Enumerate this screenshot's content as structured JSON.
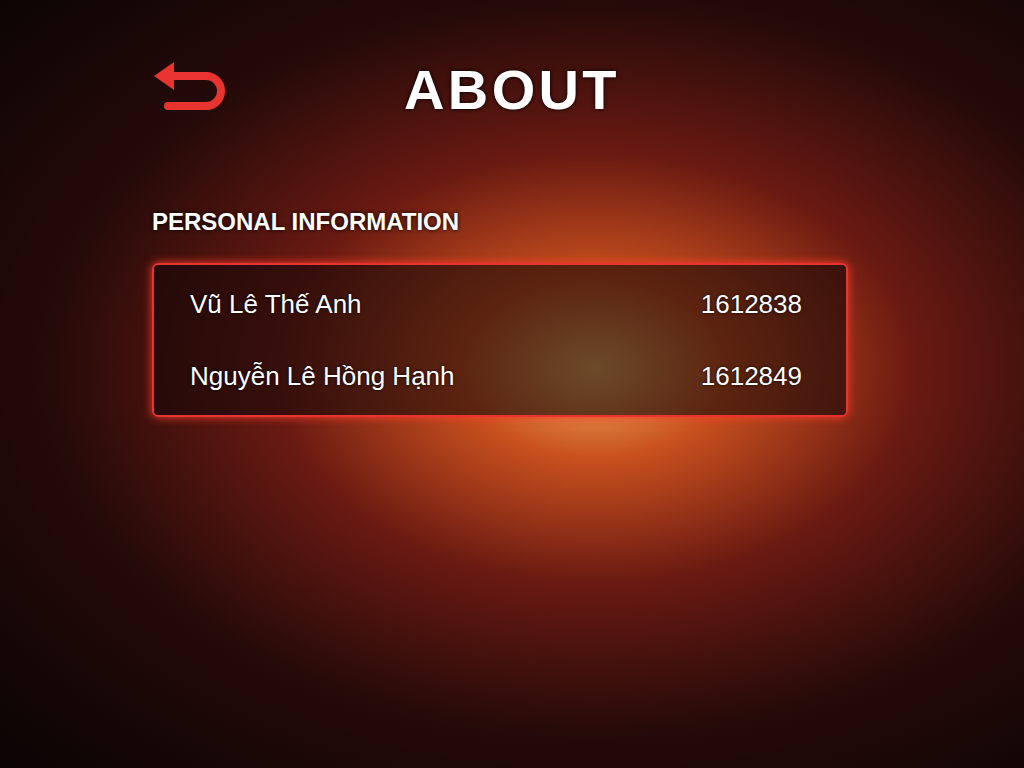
{
  "screen": {
    "title": "ABOUT"
  },
  "section": {
    "heading": "PERSONAL INFORMATION"
  },
  "members": [
    {
      "name": "Vũ Lê Thế Anh",
      "id": "1612838"
    },
    {
      "name": "Nguyễn Lê Hồng Hạnh",
      "id": "1612849"
    }
  ]
}
